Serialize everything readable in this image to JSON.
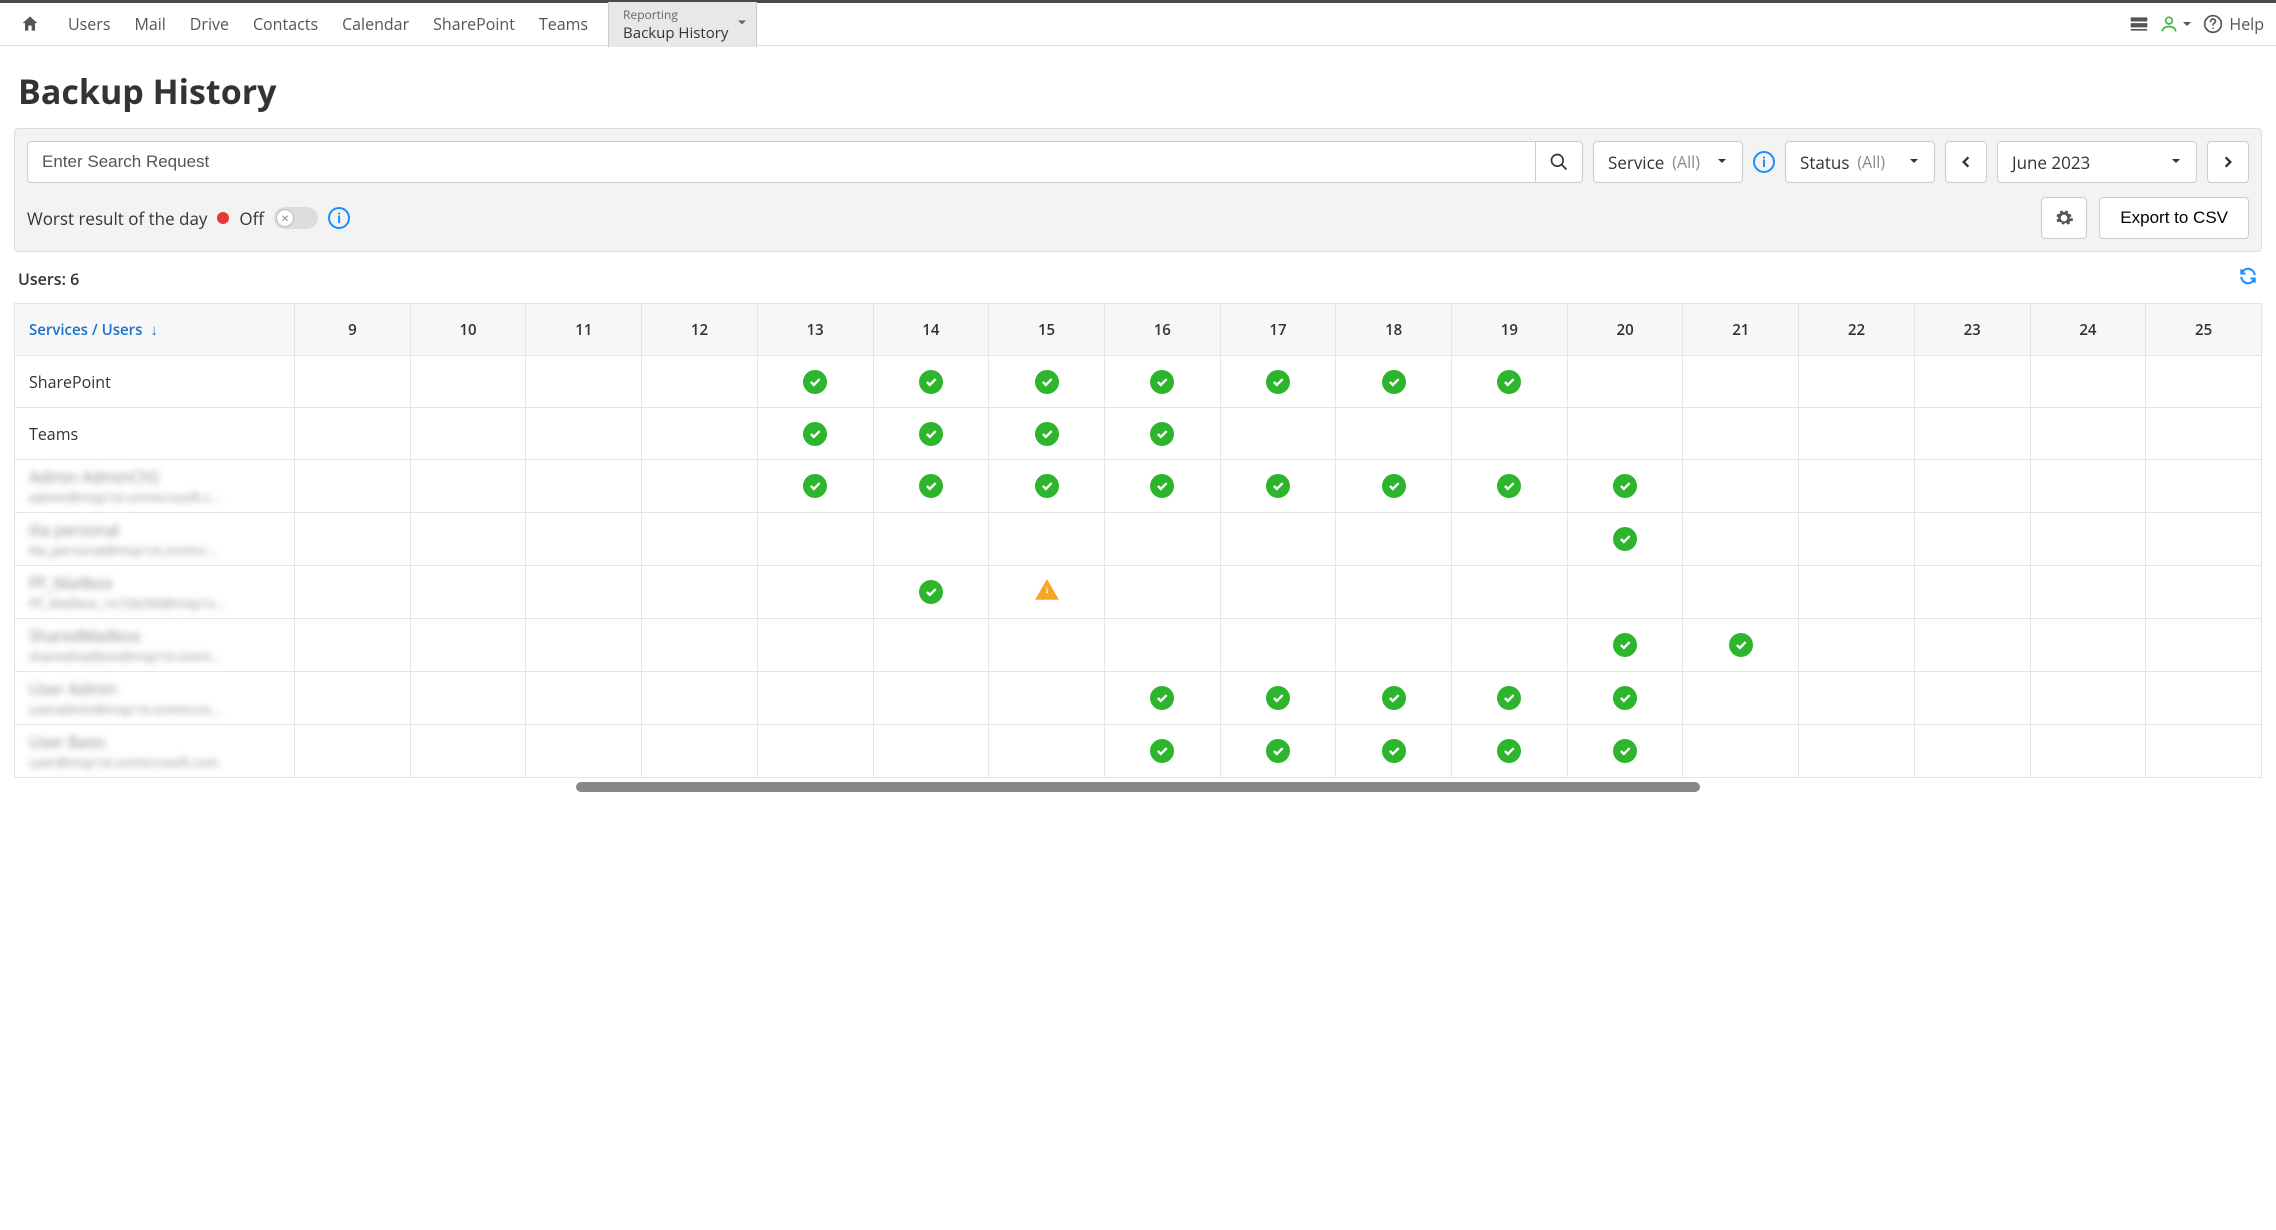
{
  "nav": {
    "items": [
      "Users",
      "Mail",
      "Drive",
      "Contacts",
      "Calendar",
      "SharePoint",
      "Teams"
    ],
    "reporting_label": "Reporting",
    "reporting_sub": "Backup History",
    "help": "Help"
  },
  "page": {
    "title": "Backup History"
  },
  "filters": {
    "search_placeholder": "Enter Search Request",
    "service_label": "Service",
    "service_scope": "(All)",
    "status_label": "Status",
    "status_scope": "(All)",
    "month": "June 2023",
    "worst_label": "Worst result of the day",
    "worst_state": "Off",
    "export_label": "Export to CSV"
  },
  "summary": {
    "users_label": "Users: 6"
  },
  "grid": {
    "first_col_header": "Services / Users",
    "days": [
      "9",
      "10",
      "11",
      "12",
      "13",
      "14",
      "15",
      "16",
      "17",
      "18",
      "19",
      "20",
      "21",
      "22",
      "23",
      "24",
      "25"
    ],
    "rows": [
      {
        "name": "SharePoint",
        "sub": "",
        "blurred": false,
        "cells": {
          "13": "ok",
          "14": "ok",
          "15": "ok",
          "16": "ok",
          "17": "ok",
          "18": "ok",
          "19": "ok"
        }
      },
      {
        "name": "Teams",
        "sub": "",
        "blurred": false,
        "svc_divider": true,
        "cells": {
          "13": "ok",
          "14": "ok",
          "15": "ok",
          "16": "ok"
        }
      },
      {
        "name": "Admin AdminChS",
        "sub": "admin@msp1st.onmicrosoft.c…",
        "blurred": true,
        "cells": {
          "13": "ok",
          "14": "ok",
          "15": "ok",
          "16": "ok",
          "17": "ok",
          "18": "ok",
          "19": "ok",
          "20": "ok"
        }
      },
      {
        "name": "ilia personal",
        "sub": "ilia_personal@msp1st.onmicr…",
        "blurred": true,
        "cells": {
          "20": "ok"
        }
      },
      {
        "name": "PF_Mailbox",
        "sub": "PF_Mailbox_1e72b29d@msp1s…",
        "blurred": true,
        "cells": {
          "14": "ok",
          "15": "warn"
        }
      },
      {
        "name": "SharedMailbox",
        "sub": "sharedmailbox@msp1st.onmi…",
        "blurred": true,
        "cells": {
          "20": "ok",
          "21": "ok"
        }
      },
      {
        "name": "User Admin",
        "sub": "useradmin@msp1st.onmicros…",
        "blurred": true,
        "cells": {
          "16": "ok",
          "17": "ok",
          "18": "ok",
          "19": "ok",
          "20": "ok"
        }
      },
      {
        "name": "User Basic",
        "sub": "user@msp1st.onmicrosoft.com",
        "blurred": true,
        "cells": {
          "16": "ok",
          "17": "ok",
          "18": "ok",
          "19": "ok",
          "20": "ok"
        }
      }
    ]
  },
  "colors": {
    "ok": "#2eb52e",
    "warn": "#f5a623",
    "accent": "#1a73c9"
  }
}
